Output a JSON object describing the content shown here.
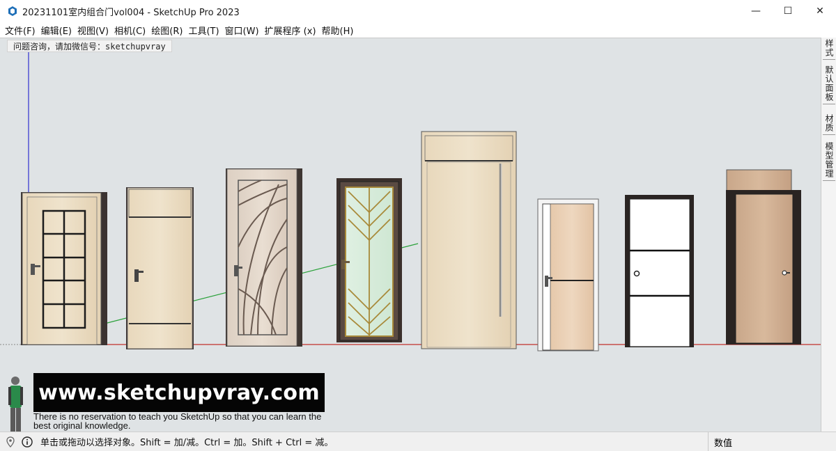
{
  "window": {
    "title": "20231101室内组合门vol004 - SketchUp Pro 2023",
    "minimize": "—",
    "maximize": "☐",
    "close": "✕"
  },
  "menu": [
    "文件(F)",
    "编辑(E)",
    "视图(V)",
    "相机(C)",
    "绘图(R)",
    "工具(T)",
    "窗口(W)",
    "扩展程序 (x)",
    "帮助(H)"
  ],
  "viewport": {
    "hint": "问题咨询，请加微信号：sketchupvray"
  },
  "tray_tabs": [
    "样式",
    "默认面板",
    "材质",
    "模型管理"
  ],
  "watermark": {
    "url": "www.sketchupvray.com",
    "tagline": "There is no reservation to teach you SketchUp so that you can learn the best original knowledge."
  },
  "status": {
    "message": "单击或拖动以选择对象。Shift = 加/减。Ctrl = 加。Shift + Ctrl = 减。",
    "measurements_label": "数值",
    "measurements_value": ""
  },
  "colors": {
    "viewport_bg": "#dfe3e5",
    "axis_red": "#c0302a",
    "axis_green": "#2aa13a",
    "axis_blue": "#3030d0",
    "wood_light": "#e9dcc4",
    "wood_dark": "#3a302c"
  },
  "icons": {
    "app": "sketchup-logo-icon",
    "geo": "geo-location-icon",
    "info": "info-icon"
  }
}
